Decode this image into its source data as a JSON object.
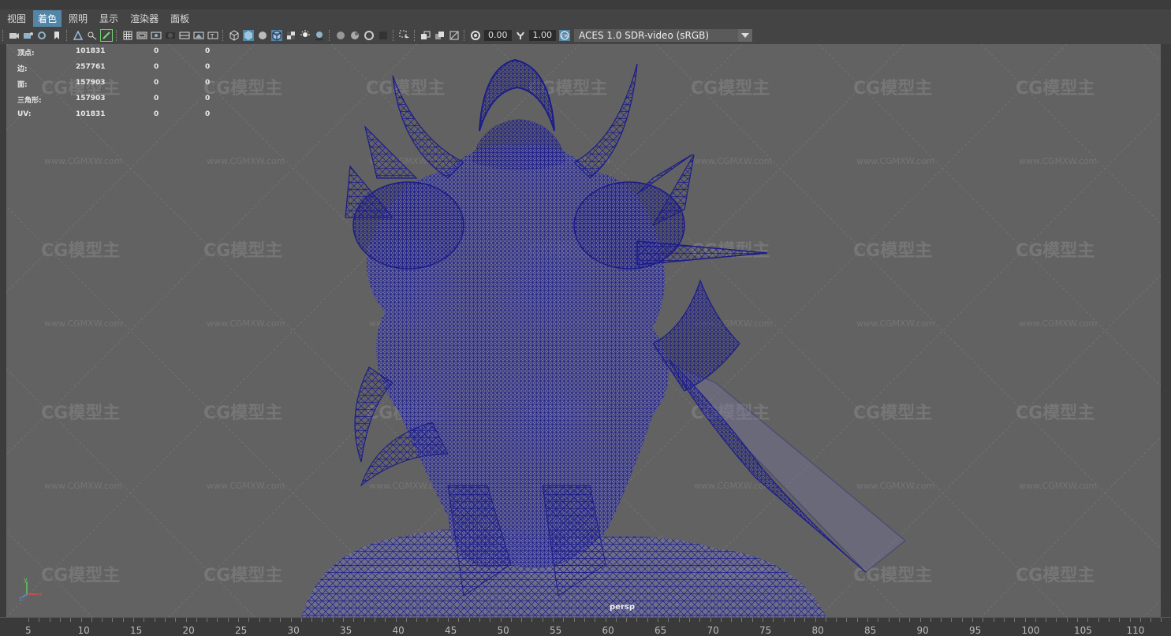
{
  "menus": [
    "视图",
    "着色",
    "照明",
    "显示",
    "渲染器",
    "面板"
  ],
  "active_menu_index": 1,
  "toolbar": {
    "exposure_value": "0.00",
    "gamma_value": "1.00",
    "color_space": "ACES 1.0 SDR-video (sRGB)"
  },
  "hud": {
    "rows": [
      {
        "label": "顶点:",
        "v1": "101831",
        "v2": "0",
        "v3": "0"
      },
      {
        "label": "边:",
        "v1": "257761",
        "v2": "0",
        "v3": "0"
      },
      {
        "label": "面:",
        "v1": "157903",
        "v2": "0",
        "v3": "0"
      },
      {
        "label": "三角形:",
        "v1": "157903",
        "v2": "0",
        "v3": "0"
      },
      {
        "label": "UV:",
        "v1": "101831",
        "v2": "0",
        "v3": "0"
      }
    ]
  },
  "camera_name": "persp",
  "watermark_url": "www.CGMXW.com",
  "axis": {
    "y": "y",
    "x": "x",
    "z": "z"
  },
  "timeline": {
    "ticks": [
      "5",
      "10",
      "15",
      "20",
      "25",
      "30",
      "35",
      "40",
      "45",
      "50",
      "55",
      "60",
      "65",
      "70",
      "75",
      "80",
      "85",
      "90",
      "95",
      "100",
      "105",
      "110"
    ]
  },
  "colors": {
    "viewport_bg": "#626262",
    "wireframe": "#1c1c8a",
    "active_menu": "#5285a6"
  }
}
